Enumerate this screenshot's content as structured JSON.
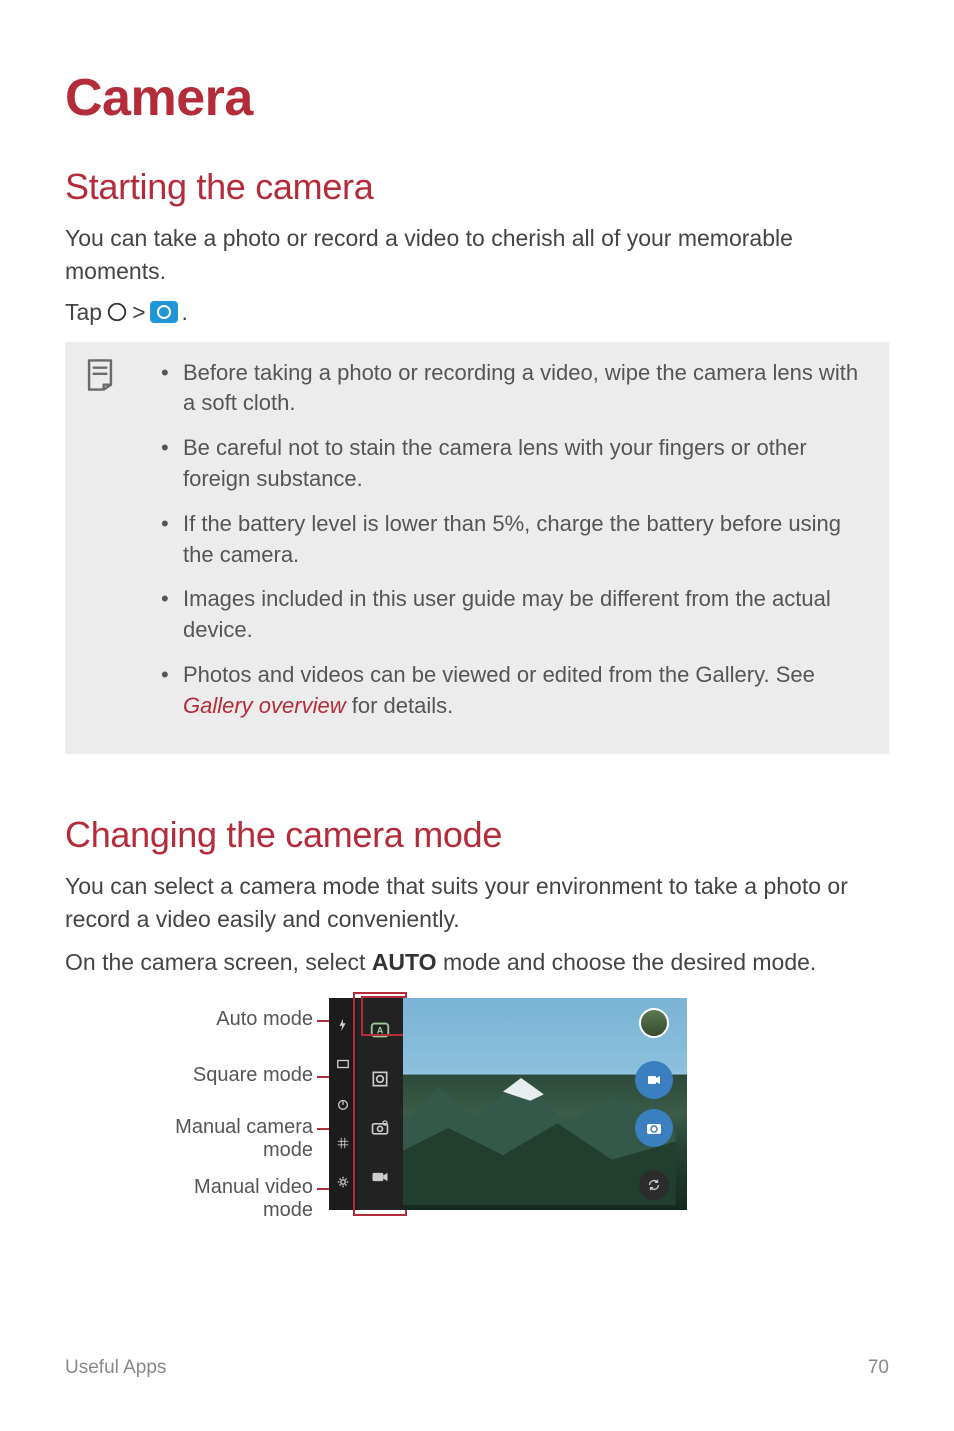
{
  "title": "Camera",
  "section1": {
    "heading": "Starting the camera",
    "para": "You can take a photo or record a video to cherish all of your memorable moments.",
    "tap_prefix": "Tap",
    "tap_sep": ">",
    "tap_suffix": "."
  },
  "notes": {
    "items": [
      "Before taking a photo or recording a video, wipe the camera lens with a soft cloth.",
      "Be careful not to stain the camera lens with your fingers or other foreign substance.",
      "If the battery level is lower than 5%, charge the battery before using the camera.",
      "Images included in this user guide may be different from the actual device."
    ],
    "last_prefix": "Photos and videos can be viewed or edited from the Gallery. See ",
    "last_link": "Gallery overview",
    "last_suffix": " for details."
  },
  "section2": {
    "heading": "Changing the camera mode",
    "para1": "You can select a camera mode that suits your environment to take a photo or record a video easily and conveniently.",
    "para2_pre": "On the camera screen, select ",
    "para2_bold": "AUTO",
    "para2_post": " mode and choose the desired mode."
  },
  "figure": {
    "labels": {
      "auto": "Auto mode",
      "square": "Square mode",
      "manual_cam_l1": "Manual camera",
      "manual_cam_l2": "mode",
      "manual_vid_l1": "Manual video",
      "manual_vid_l2": "mode"
    }
  },
  "footer": {
    "section": "Useful Apps",
    "page": "70"
  }
}
